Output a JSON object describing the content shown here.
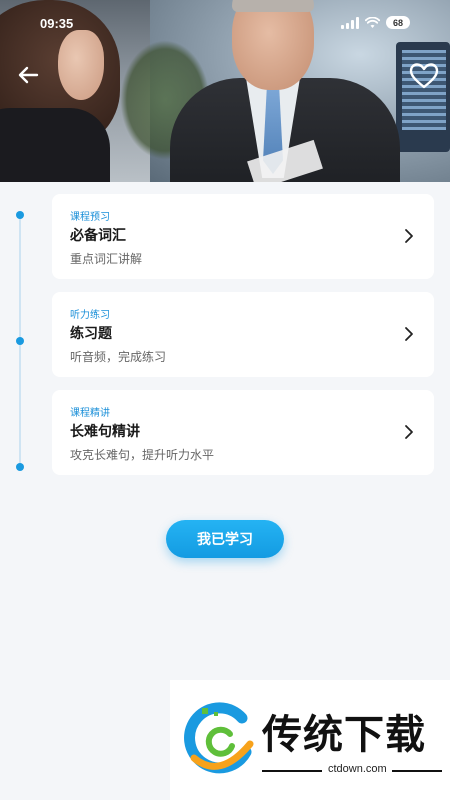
{
  "status_bar": {
    "time": "09:35",
    "battery": "68"
  },
  "header": {
    "back_icon": "arrow-left-icon",
    "favorite_icon": "heart-outline-icon"
  },
  "lessons": [
    {
      "tag": "课程预习",
      "title": "必备词汇",
      "subtitle": "重点词汇讲解"
    },
    {
      "tag": "听力练习",
      "title": "练习题",
      "subtitle": "听音频，完成练习"
    },
    {
      "tag": "课程精讲",
      "title": "长难句精讲",
      "subtitle": "攻克长难句，提升听力水平"
    }
  ],
  "action": {
    "learned_label": "我已学习"
  },
  "watermark": {
    "brand": "传统下载",
    "url": "ctdown.com"
  },
  "colors": {
    "accent": "#1a9ae0",
    "background": "#f4f6f9"
  }
}
